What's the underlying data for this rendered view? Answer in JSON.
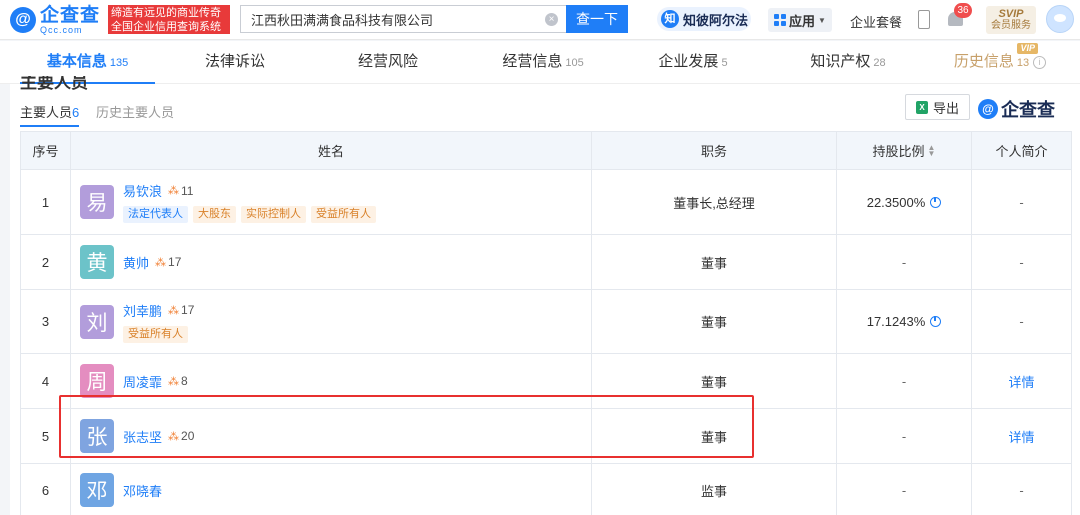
{
  "header": {
    "logo_cn": "企查查",
    "logo_en": "Qcc.com",
    "logo_mark": "@",
    "slogan_line1": "缔造有远见的商业传奇",
    "slogan_line2": "全国企业信用查询系统",
    "search_value": "江西秋田满满食品科技有限公司",
    "search_button": "查一下",
    "zhibi_label": "知彼阿尔法",
    "zhibi_icon": "知",
    "app_label": "应用",
    "suite_label": "企业套餐",
    "notification_count": "36",
    "svip_label": "SVIP",
    "svip_sub": "会员服务"
  },
  "tabs": [
    {
      "label": "基本信息",
      "count": "135"
    },
    {
      "label": "法律诉讼",
      "count": ""
    },
    {
      "label": "经营风险",
      "count": ""
    },
    {
      "label": "经营信息",
      "count": "105"
    },
    {
      "label": "企业发展",
      "count": "5"
    },
    {
      "label": "知识产权",
      "count": "28"
    },
    {
      "label": "历史信息",
      "count": "13",
      "vip_tag": "VIP"
    }
  ],
  "section": {
    "title": "主要人员",
    "subtab_active": "主要人员",
    "subtab_active_count": "6",
    "subtab_history": "历史主要人员",
    "export_label": "导出",
    "xls_icon": "X",
    "brand_mark": "@",
    "brand_text": "企查查"
  },
  "table": {
    "headers": {
      "index": "序号",
      "name": "姓名",
      "position": "职务",
      "share": "持股比例",
      "bio": "个人简介"
    },
    "rows": [
      {
        "index": "1",
        "avatar_char": "易",
        "avatar_color": "#b29ddb",
        "name": "易钦浪",
        "rel_count": "11",
        "tags": [
          "法定代表人",
          "大股东",
          "实际控制人",
          "受益所有人"
        ],
        "position": "董事长,总经理",
        "share": "22.3500%",
        "bio": "-"
      },
      {
        "index": "2",
        "avatar_char": "黄",
        "avatar_color": "#6cc3c9",
        "name": "黄帅",
        "rel_count": "17",
        "tags": [],
        "position": "董事",
        "share": "-",
        "bio": "-"
      },
      {
        "index": "3",
        "avatar_char": "刘",
        "avatar_color": "#b29ddb",
        "name": "刘幸鹏",
        "rel_count": "17",
        "tags": [
          "受益所有人"
        ],
        "position": "董事",
        "share": "17.1243%",
        "bio": "-"
      },
      {
        "index": "4",
        "avatar_char": "周",
        "avatar_color": "#e48dc0",
        "name": "周凌霏",
        "rel_count": "8",
        "tags": [],
        "position": "董事",
        "share": "-",
        "bio": "详情"
      },
      {
        "index": "5",
        "avatar_char": "张",
        "avatar_color": "#7fa4e0",
        "name": "张志坚",
        "rel_count": "20",
        "tags": [],
        "position": "董事",
        "share": "-",
        "bio": "详情"
      },
      {
        "index": "6",
        "avatar_char": "邓",
        "avatar_color": "#6fa5e3",
        "name": "邓晓春",
        "rel_count": "",
        "tags": [],
        "position": "监事",
        "share": "-",
        "bio": "-"
      }
    ]
  },
  "colors": {
    "accent": "#1f7ef7",
    "highlight": "#e8302f",
    "tag_orange": "#d9822b"
  }
}
